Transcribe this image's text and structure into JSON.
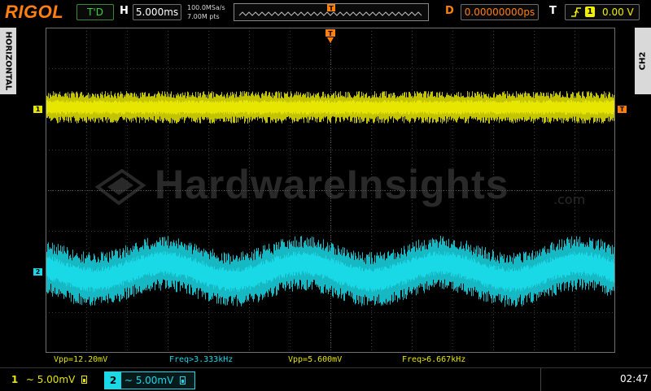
{
  "topbar": {
    "brand": "RIGOL",
    "run_state": "T'D",
    "horizontal_letter": "H",
    "timebase": "5.000ms",
    "sample_rate": "100.0MSa/s",
    "memory_depth": "7.00M pts",
    "delay_letter": "D",
    "delay_value": "0.00000000ps",
    "trigger_letter": "T",
    "trigger_source": "1",
    "trigger_level": "0.00 V"
  },
  "side": {
    "left_tab": "HORIZONTAL",
    "right_tab": "CH2"
  },
  "channels": {
    "ch1_marker": "1",
    "ch2_marker": "2",
    "trigger_marker": "T"
  },
  "watermark": {
    "text": "HardwareInsights",
    "suffix": ".com"
  },
  "measurements": {
    "ch1_vpp": "Vpp=12.20mV",
    "ch1_freq": "Freq>3.333kHz",
    "ch2_vpp": "Vpp=5.600mV",
    "ch2_freq": "Freq>6.667kHz"
  },
  "bottombar": {
    "ch1_num": "1",
    "ch1_scale": "~ 5.00mV",
    "ch2_num": "2",
    "ch2_scale": "~ 5.00mV",
    "clock": "02:47"
  },
  "colors": {
    "ch1": "#e6e600",
    "ch2": "#19d9e6",
    "trigger": "#ff7f0f",
    "brand": "#ff7f0f"
  }
}
